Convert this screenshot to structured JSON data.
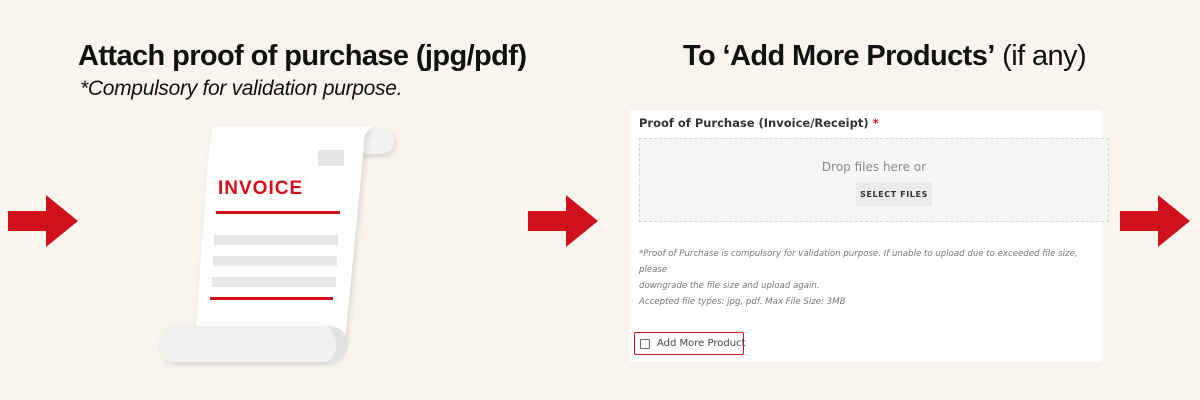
{
  "colors": {
    "background": "#f8f4ee",
    "accent_red": "#d0101b",
    "arrow_red": "#d0101b",
    "panel_background": "#ffffff"
  },
  "steps": {
    "attach": {
      "heading": "Attach proof of purchase (jpg/pdf)",
      "subheading": "*Compulsory for validation purpose.",
      "illustration": {
        "icon": "invoice-document-icon",
        "title": "INVOICE"
      }
    },
    "add_more": {
      "heading_bold": "To ‘Add More Products’",
      "heading_regular": " (if any)"
    }
  },
  "arrows": [
    {
      "icon": "right-arrow-icon"
    },
    {
      "icon": "right-arrow-icon"
    },
    {
      "icon": "right-arrow-icon"
    }
  ],
  "form": {
    "field_label": "Proof of Purchase (Invoice/Receipt)",
    "required_marker": "*",
    "dropzone_text": "Drop files here or",
    "select_files_label": "SELECT FILES",
    "note_line1": "*Proof of Purchase is compulsory for validation purpose. If unable to upload due to exceeded file size, please",
    "note_line2": "downgrade the file size and upload again.",
    "note_line3": "Accepted file types: jpg, pdf. Max File Size: 3MB",
    "add_more_label": "Add More Product",
    "add_more_checked": false
  }
}
